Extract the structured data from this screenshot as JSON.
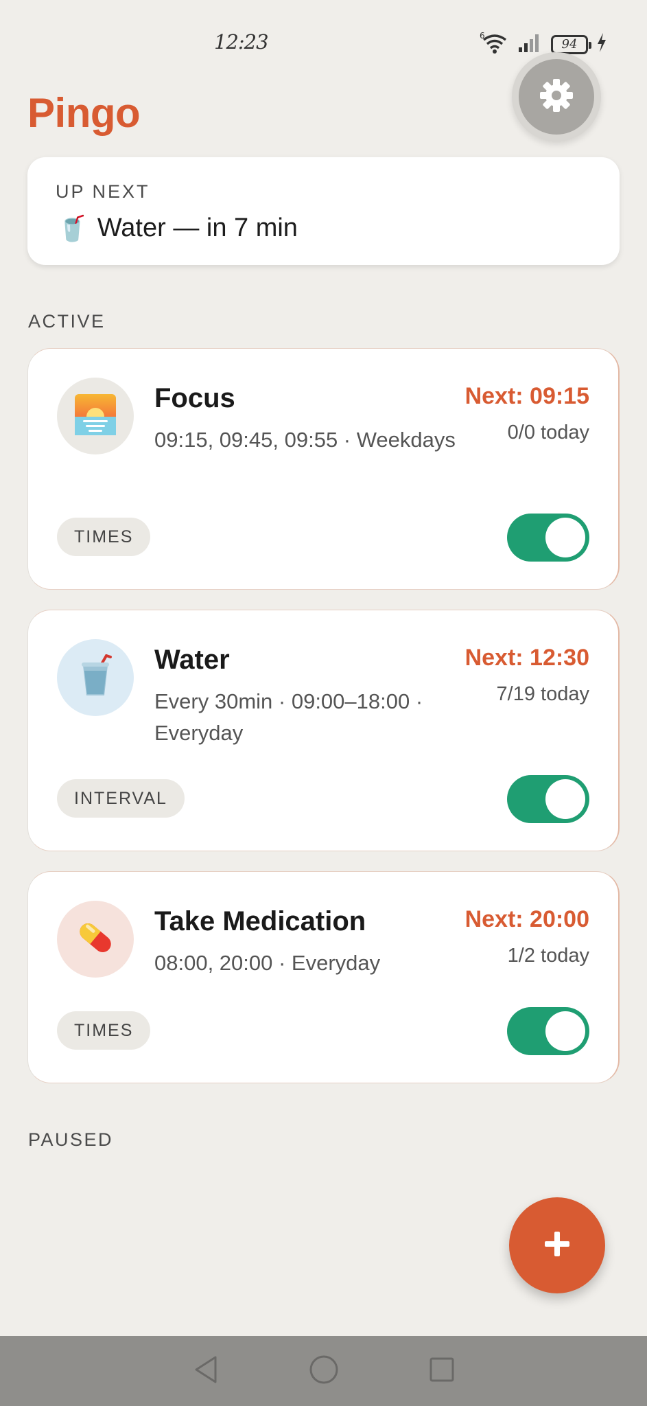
{
  "status_bar": {
    "time": "12:23",
    "battery": "94",
    "icons": [
      "wifi-icon",
      "signal-icon",
      "battery-icon",
      "charging-icon"
    ]
  },
  "app": {
    "title": "Pingo",
    "settings_icon": "gear-icon"
  },
  "up_next": {
    "label": "UP NEXT",
    "emoji": "🥤",
    "text": "Water — in 7 min"
  },
  "sections": {
    "active": "ACTIVE",
    "paused": "PAUSED"
  },
  "reminders": [
    {
      "icon": "sunrise-icon",
      "emoji": "🌅",
      "icon_bg": "#ebe9e4",
      "title": "Focus",
      "schedule": "09:15, 09:45, 09:55 · Weekdays",
      "next": "Next: 09:15",
      "count": "0/0 today",
      "type": "TIMES",
      "enabled": true
    },
    {
      "icon": "cup-icon",
      "emoji": "🥤",
      "icon_bg": "#dcebf5",
      "title": "Water",
      "schedule": "Every 30min · 09:00–18:00 · Everyday",
      "next": "Next: 12:30",
      "count": "7/19 today",
      "type": "INTERVAL",
      "enabled": true
    },
    {
      "icon": "pill-icon",
      "emoji": "💊",
      "icon_bg": "#f6e2dc",
      "title": "Take Medication",
      "schedule": "08:00, 20:00 · Everyday",
      "next": "Next: 20:00",
      "count": "1/2 today",
      "type": "TIMES",
      "enabled": true
    }
  ],
  "fab": {
    "icon": "plus-icon"
  },
  "nav_bar": {
    "icons": [
      "back-icon",
      "home-icon",
      "recents-icon"
    ]
  },
  "colors": {
    "accent": "#d85b32",
    "toggle_on": "#1f9e72",
    "background": "#f0eeea"
  }
}
